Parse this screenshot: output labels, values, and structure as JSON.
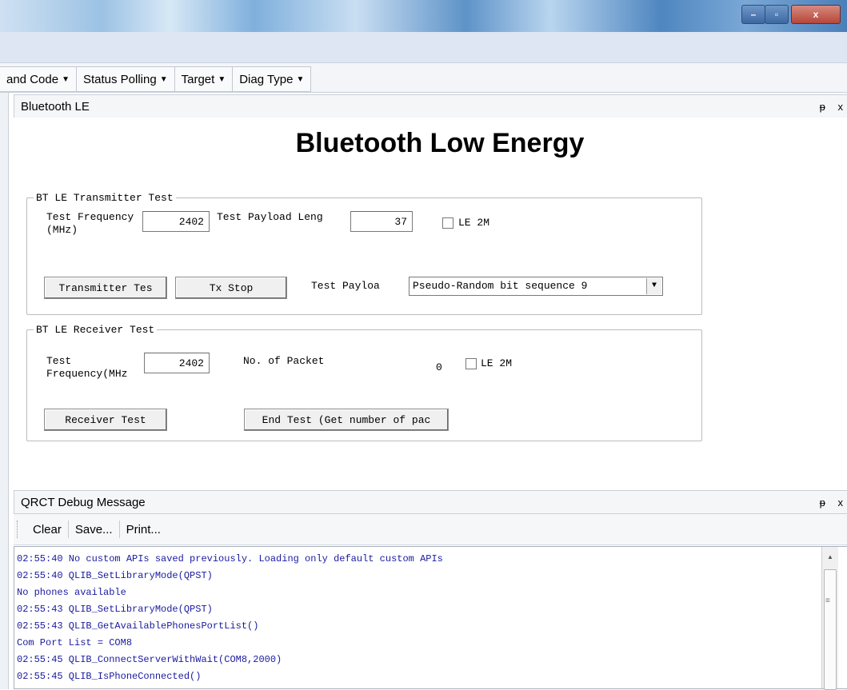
{
  "window": {
    "minimize": "–",
    "maximize": "▫",
    "close": "x"
  },
  "toolbar": {
    "items": [
      {
        "label": "and Code"
      },
      {
        "label": "Status Polling"
      },
      {
        "label": "Target"
      },
      {
        "label": "Diag Type"
      }
    ]
  },
  "ble_panel": {
    "header": "Bluetooth LE",
    "pin_icons": "ᵽ x",
    "title": "Bluetooth Low Energy",
    "tx": {
      "legend": "BT LE Transmitter Test",
      "freq_label_line1": "Test Frequency",
      "freq_label_line2": "(MHz)",
      "freq_value": "2402",
      "payload_len_label": "Test Payload Leng",
      "payload_len_value": "37",
      "le2m_label": "LE 2M",
      "le2m_checked": false,
      "tx_test_button": "Transmitter Tes",
      "tx_stop_button": "Tx Stop",
      "payload_label": "Test Payloa",
      "payload_selected": "Pseudo-Random bit sequence 9"
    },
    "rx": {
      "legend": "BT LE Receiver Test",
      "freq_label_line1": "Test",
      "freq_label_line2": "Frequency(MHz",
      "freq_value": "2402",
      "packets_label": "No. of Packet",
      "packets_value": "0",
      "le2m_label": "LE 2M",
      "le2m_checked": false,
      "rx_test_button": "Receiver Test",
      "end_test_button": "End Test (Get number of pac"
    }
  },
  "debug_panel": {
    "header": "QRCT Debug Message",
    "pin_icons": "ᵽ x",
    "buttons": {
      "clear": "Clear",
      "save": "Save...",
      "print": "Print..."
    },
    "lines": [
      "02:55:40  No custom APIs saved previously. Loading only default custom APIs",
      "02:55:40  QLIB_SetLibraryMode(QPST)",
      "No phones available",
      "02:55:43  QLIB_SetLibraryMode(QPST)",
      "02:55:43  QLIB_GetAvailablePhonesPortList()",
      "Com Port List = COM8",
      "02:55:45  QLIB_ConnectServerWithWait(COM8,2000)",
      "02:55:45  QLIB_IsPhoneConnected()"
    ]
  }
}
